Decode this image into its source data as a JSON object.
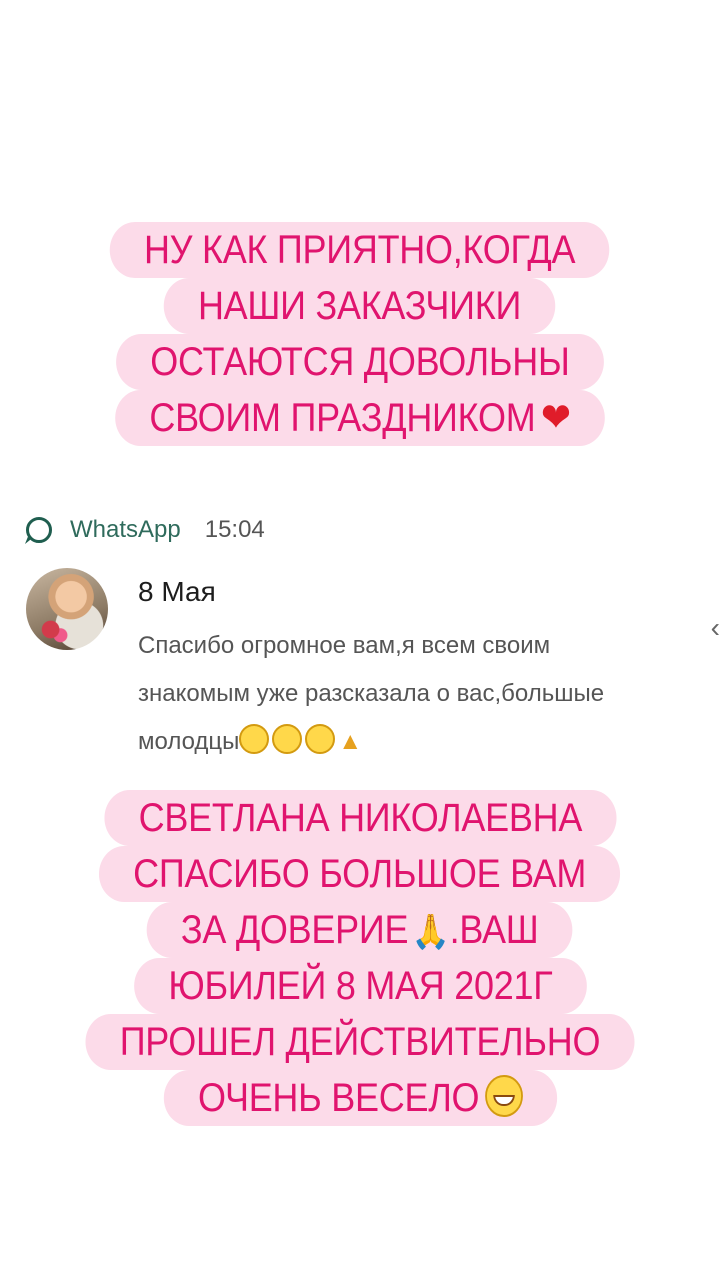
{
  "caption_top": {
    "lines": [
      "НУ КАК ПРИЯТНО,КОГДА",
      "НАШИ ЗАКАЗЧИКИ",
      "ОСТАЮТСЯ ДОВОЛЬНЫ",
      "СВОИМ ПРАЗДНИКОМ"
    ],
    "emoji": "❤"
  },
  "notification": {
    "app_name": "WhatsApp",
    "time": "15:04",
    "sender": "8 Мая",
    "message": "Спасибо огромное вам,я всем своим знакомым уже разсказала о вас,большые молодцы"
  },
  "caption_bottom": {
    "lines": [
      "СВЕТЛАНА НИКОЛАЕВНА",
      "СПАСИБО БОЛЬШОЕ ВАМ",
      "ЗА ДОВЕРИЕ",
      ".ВАШ",
      "ЮБИЛЕЙ 8 МАЯ 2021Г",
      "ПРОШЕЛ ДЕЙСТВИТЕЛЬНО",
      "ОЧЕНЬ ВЕСЕЛО"
    ]
  },
  "colors": {
    "caption_bg": "#fcdbe9",
    "caption_text": "#e0146e",
    "whatsapp_green": "#2f6b5c"
  },
  "icons": [
    "whatsapp-icon",
    "heart-emoji",
    "smiling-emoji",
    "thumbs-up-emoji",
    "praying-hands-emoji",
    "grinning-emoji",
    "back-arrow-icon"
  ]
}
